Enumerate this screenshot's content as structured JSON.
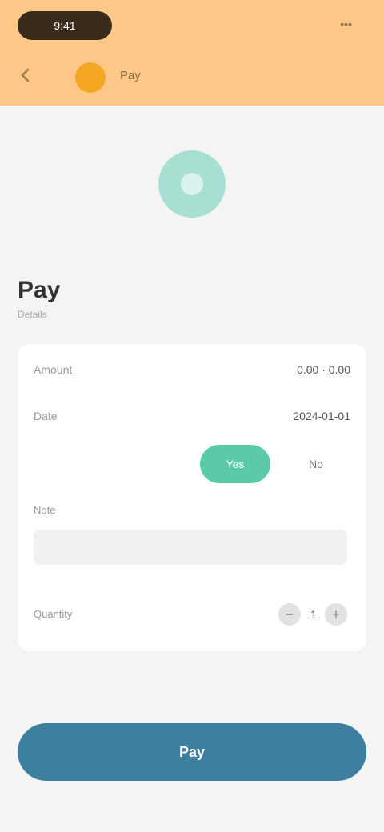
{
  "header": {
    "status_text": "9:41",
    "top_right": "•••",
    "brand_name": "Pay"
  },
  "section": {
    "title": "Pay",
    "subtitle": "Details"
  },
  "card": {
    "rows": [
      {
        "label": "Amount",
        "value": "0.00 · 0.00"
      },
      {
        "label": "Date",
        "value": "2024-01-01"
      }
    ],
    "toggle_on": "Yes",
    "toggle_off": "No",
    "note_label": "Note",
    "note_placeholder": "",
    "quantity_label": "Quantity",
    "quantity_value": "1",
    "minus": "−",
    "plus": "+"
  },
  "cta": {
    "label": "Pay"
  },
  "colors": {
    "header_bg": "#fdc787",
    "accent_green": "#5ccaa9",
    "cta_blue": "#3d7f9f"
  }
}
